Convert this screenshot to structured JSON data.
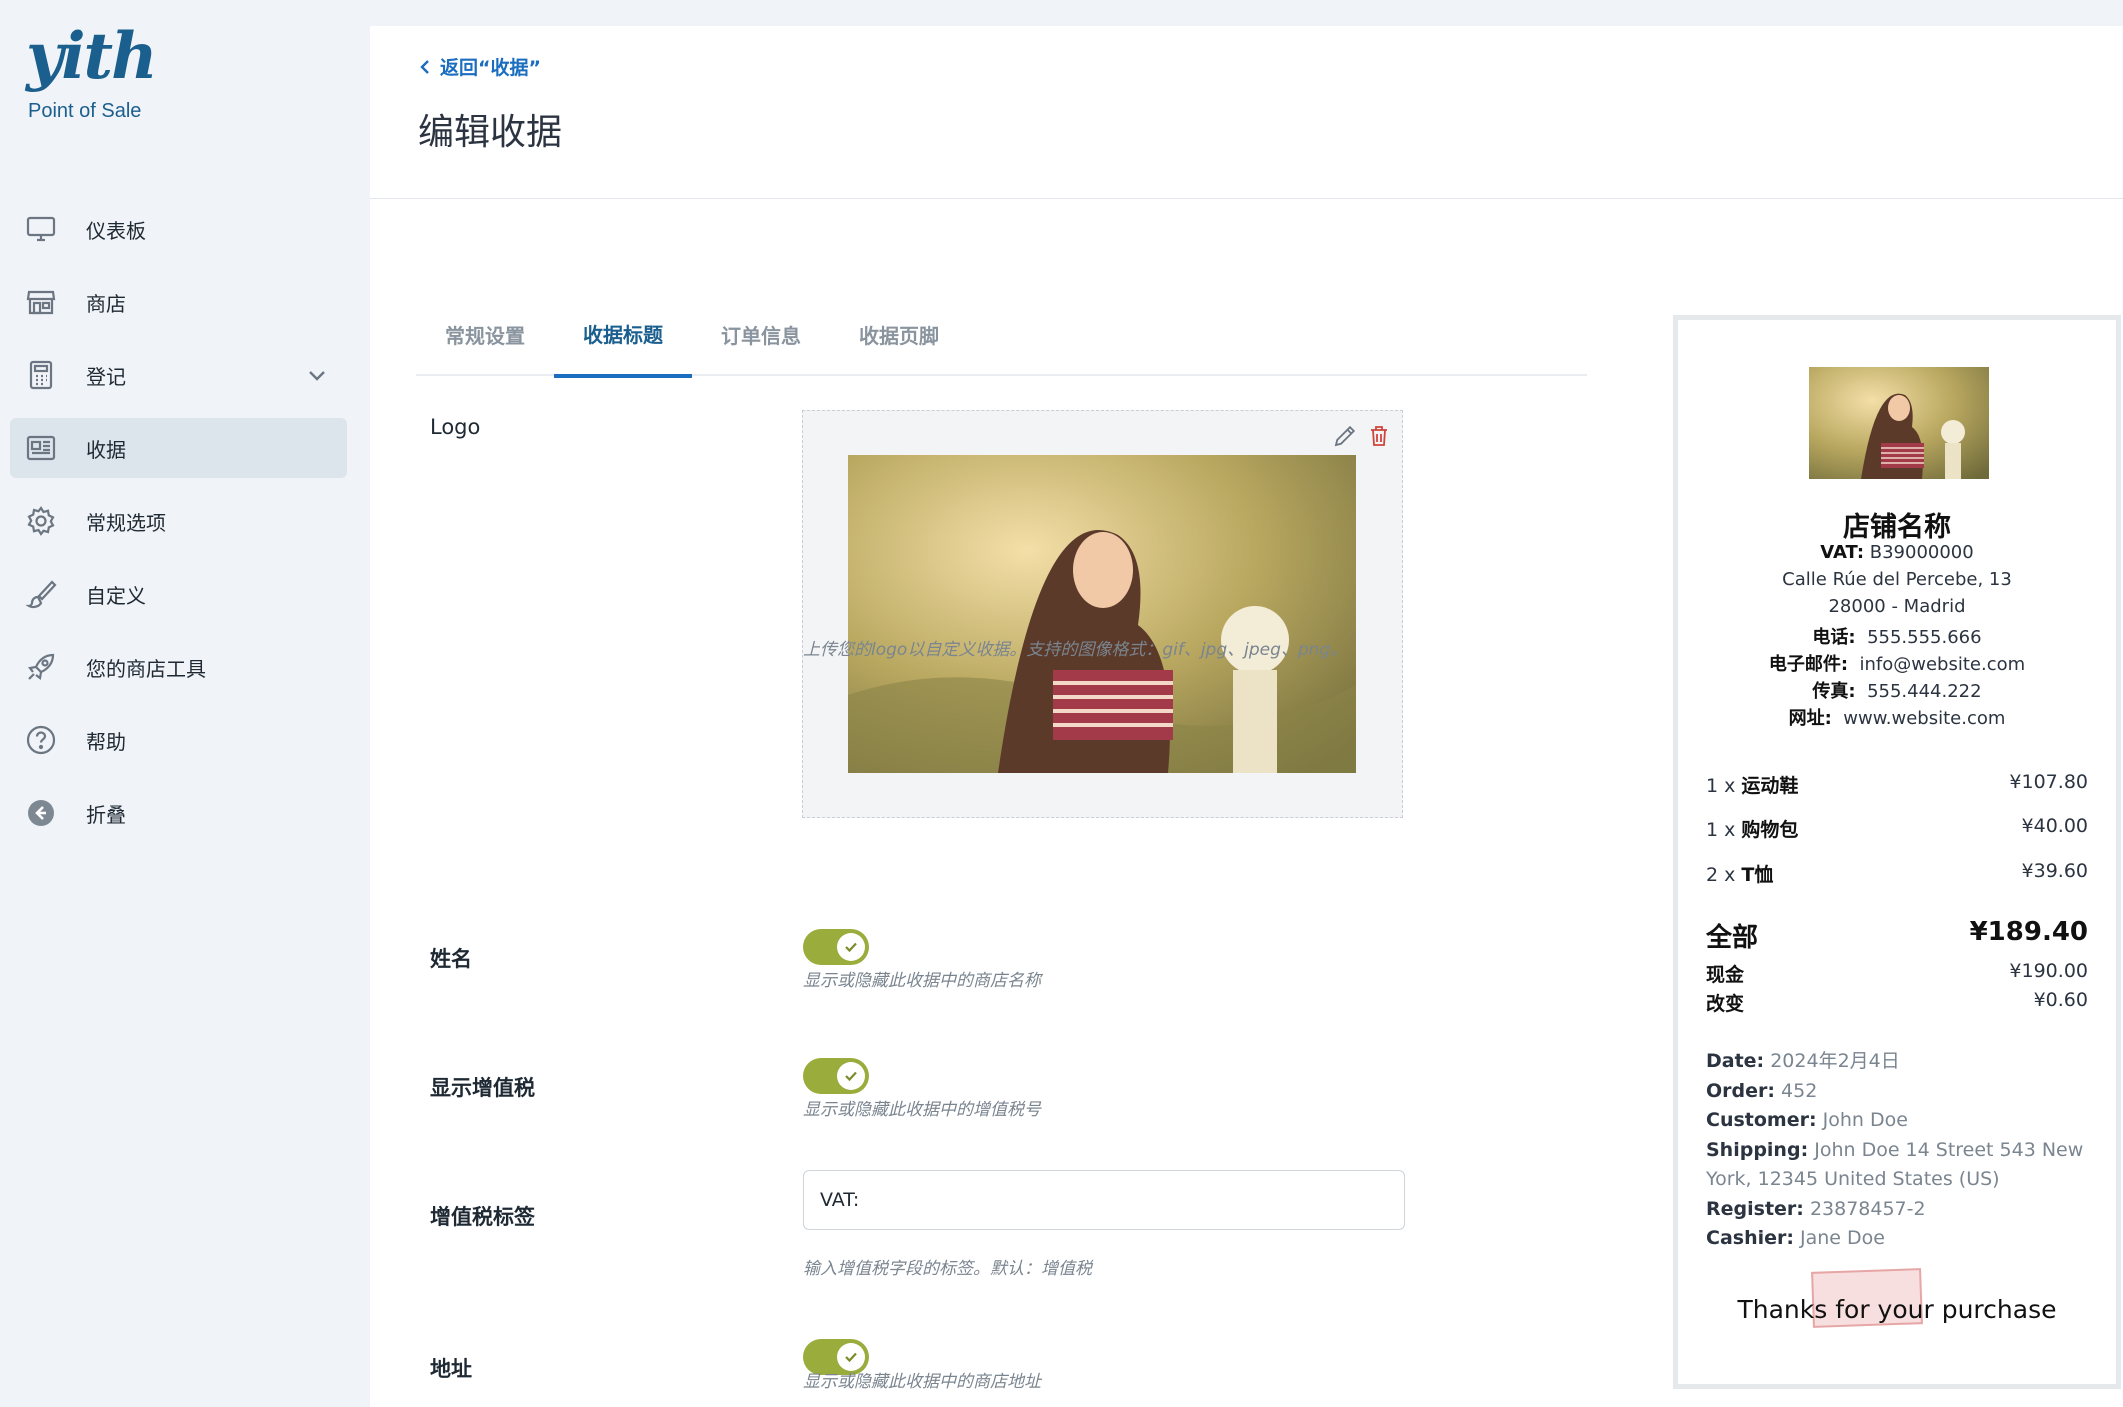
{
  "brand": {
    "logo_text": "yith",
    "subtitle": "Point of Sale",
    "color": "#1a5f8e"
  },
  "sidebar": {
    "items": [
      {
        "label": "仪表板",
        "icon": "monitor-icon"
      },
      {
        "label": "商店",
        "icon": "store-icon"
      },
      {
        "label": "登记",
        "icon": "calculator-icon",
        "has_chevron": true
      },
      {
        "label": "收据",
        "icon": "receipt-icon",
        "active": true
      },
      {
        "label": "常规选项",
        "icon": "gear-icon"
      },
      {
        "label": "自定义",
        "icon": "brush-icon"
      },
      {
        "label": "您的商店工具",
        "icon": "rocket-icon"
      },
      {
        "label": "帮助",
        "icon": "help-icon"
      },
      {
        "label": "折叠",
        "icon": "collapse-icon"
      }
    ]
  },
  "header": {
    "back_label": "返回“收据”",
    "title": "编辑收据"
  },
  "tabs": [
    {
      "label": "常规设置"
    },
    {
      "label": "收据标题",
      "active": true
    },
    {
      "label": "订单信息"
    },
    {
      "label": "收据页脚"
    }
  ],
  "form": {
    "logo": {
      "label": "Logo",
      "help": "上传您的logo以自定义收据。支持的图像格式：gif、jpg、jpeg、png。"
    },
    "name": {
      "label": "姓名",
      "enabled": true,
      "help": "显示或隐藏此收据中的商店名称"
    },
    "show_vat": {
      "label": "显示增值税",
      "enabled": true,
      "help": "显示或隐藏此收据中的增值税号"
    },
    "vat_label": {
      "label": "增值税标签",
      "value": "VAT:",
      "help": "输入增值税字段的标签。默认：增值税"
    },
    "address": {
      "label": "地址",
      "enabled": true,
      "help": "显示或隐藏此收据中的商店地址"
    }
  },
  "receipt": {
    "store_name": "店铺名称",
    "vat": {
      "label": "VAT:",
      "value": "B39000000"
    },
    "address_line1": "Calle Rúe del Percebe, 13",
    "address_line2": "28000 - Madrid",
    "phone": {
      "label": "电话:",
      "value": "555.555.666"
    },
    "email": {
      "label": "电子邮件:",
      "value": "info@website.com"
    },
    "fax": {
      "label": "传真:",
      "value": "555.444.222"
    },
    "website": {
      "label": "网址:",
      "value": "www.website.com"
    },
    "items": [
      {
        "qty": "1 x",
        "name": "运动鞋",
        "price": "¥107.80"
      },
      {
        "qty": "1 x",
        "name": "购物包",
        "price": "¥40.00"
      },
      {
        "qty": "2 x",
        "name": "T恤",
        "price": "¥39.60"
      }
    ],
    "total": {
      "label": "全部",
      "value": "¥189.40"
    },
    "cash": {
      "label": "现金",
      "value": "¥190.00"
    },
    "change": {
      "label": "改变",
      "value": "¥0.60"
    },
    "meta": {
      "date": {
        "label": "Date:",
        "value": "2024年2月4日"
      },
      "order": {
        "label": "Order:",
        "value": "452"
      },
      "customer": {
        "label": "Customer:",
        "value": "John Doe"
      },
      "shipping": {
        "label": "Shipping:",
        "value": "John Doe 14 Street 543 New York, 12345 United States (US)"
      },
      "register": {
        "label": "Register:",
        "value": "23878457-2"
      },
      "cashier": {
        "label": "Cashier:",
        "value": "Jane Doe"
      }
    },
    "thanks": "Thanks for your purchase"
  },
  "colors": {
    "accent": "#1a6dbf",
    "toggle_on": "#9aac3c",
    "active_nav": "#dde5ec"
  }
}
